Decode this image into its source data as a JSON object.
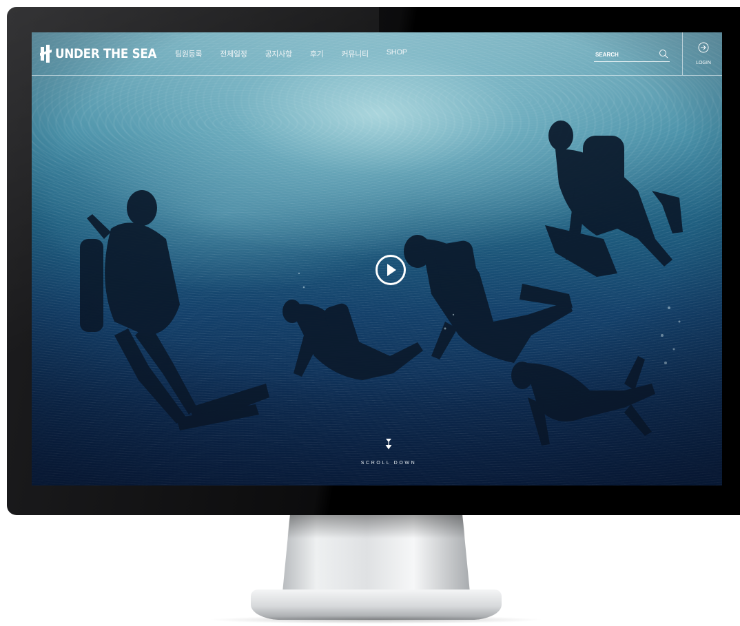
{
  "site": {
    "logo_text": "UNDER THE SEA",
    "nav": [
      {
        "label": "팀원등록"
      },
      {
        "label": "전체일정"
      },
      {
        "label": "공지사항"
      },
      {
        "label": "후기"
      },
      {
        "label": "커뮤니티"
      },
      {
        "label": "SHOP"
      }
    ],
    "search": {
      "placeholder": "SEARCH",
      "icon": "search-icon"
    },
    "login": {
      "label": "LOGIN",
      "icon": "login-arrow-icon"
    }
  },
  "hero": {
    "play_icon": "play-icon",
    "scroll_label": "SCROLL DOWN",
    "scroll_icon": "scroll-down-arrow-icon"
  },
  "colors": {
    "frame": "#000000",
    "water_light": "#9fd0d8",
    "water_deep": "#0a2246",
    "text": "#ffffff"
  }
}
